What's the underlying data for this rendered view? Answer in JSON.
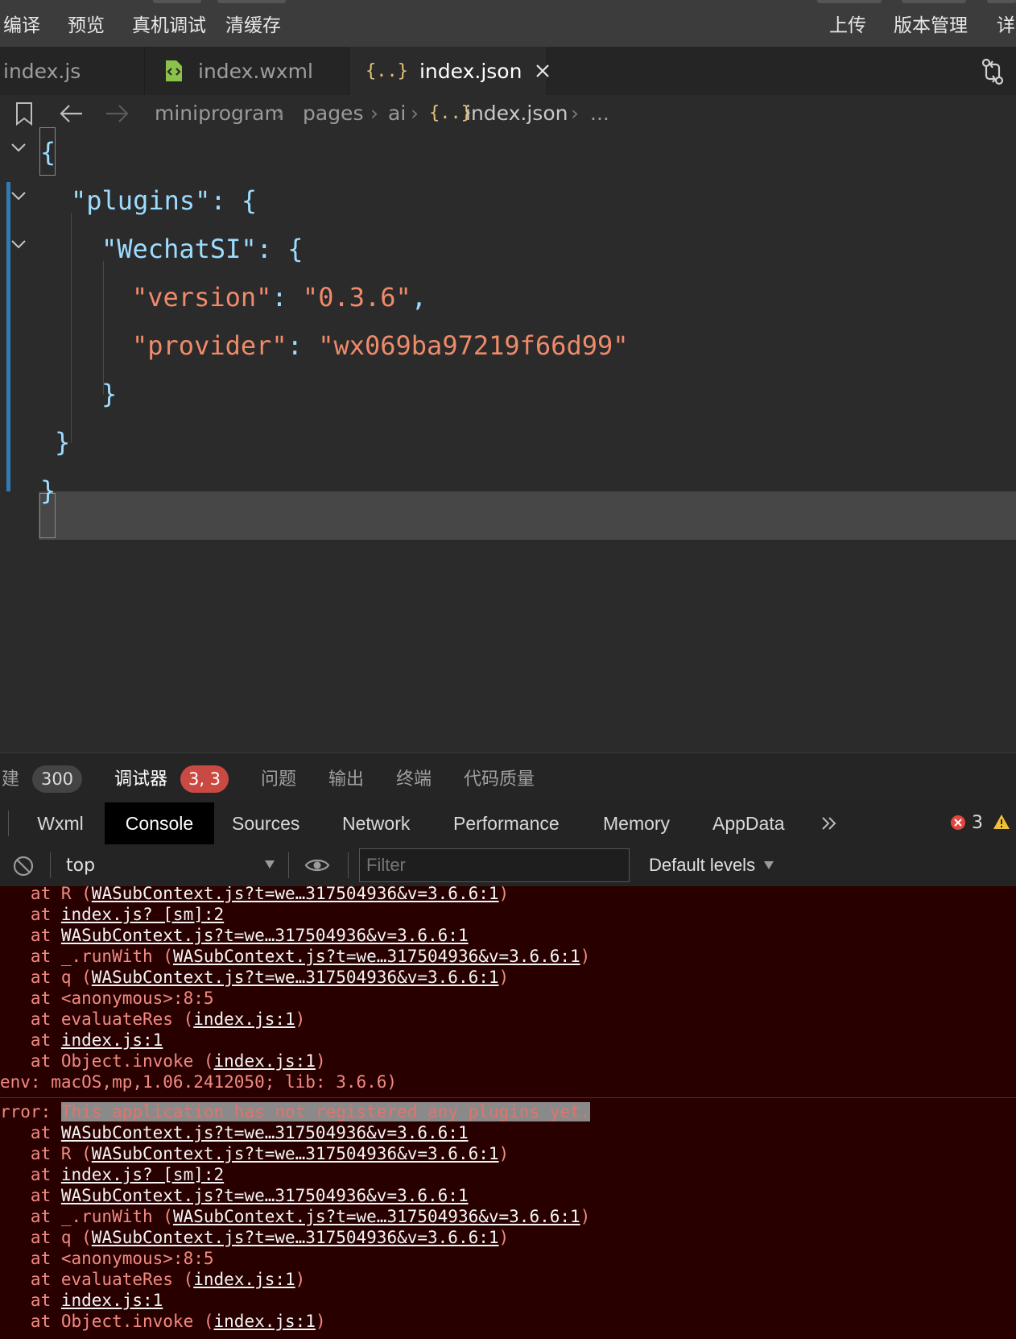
{
  "menu": {
    "left": [
      "编译",
      "预览",
      "真机调试",
      "清缓存"
    ],
    "right": [
      "上传",
      "版本管理",
      "详"
    ]
  },
  "tabs": [
    {
      "label": "index.js",
      "active": false
    },
    {
      "label": "index.wxml",
      "active": false
    },
    {
      "label": "index.json",
      "active": true
    }
  ],
  "breadcrumb": [
    "miniprogram",
    "pages",
    "ai",
    "index.json",
    "..."
  ],
  "editor": {
    "lines": [
      {
        "indent": 0,
        "key": "",
        "sep": "",
        "value": "",
        "text": "{"
      },
      {
        "indent": 1,
        "key": "\"plugins\"",
        "sep": ": ",
        "value": "{"
      },
      {
        "indent": 2,
        "key": "\"WechatSI\"",
        "sep": ": ",
        "value": "{"
      },
      {
        "indent": 3,
        "key": "\"version\"",
        "sep": ": ",
        "value": "\"0.3.6\"",
        "trail": ","
      },
      {
        "indent": 3,
        "key": "\"provider\"",
        "sep": ": ",
        "value": "\"wx069ba97219f66d99\""
      },
      {
        "indent": 2,
        "text": "}"
      },
      {
        "indent": 1,
        "text": "}"
      },
      {
        "indent": 0,
        "text": "}"
      }
    ]
  },
  "panel": {
    "build_label": "建",
    "build_count": "300",
    "debugger_label": "调试器",
    "debugger_count": "3, 3",
    "problems": "问题",
    "output": "输出",
    "terminal": "终端",
    "quality": "代码质量"
  },
  "devtools": {
    "tabs": [
      "Wxml",
      "Console",
      "Sources",
      "Network",
      "Performance",
      "Memory",
      "AppData"
    ],
    "active": "Console",
    "error_count": "3",
    "context": "top",
    "filter_placeholder": "Filter",
    "levels": "Default levels"
  },
  "console": {
    "lines": [
      {
        "pre": "   at R (",
        "link": "WASubContext.js?t=we…317504936&v=3.6.6:1",
        "post": ")"
      },
      {
        "pre": "   at ",
        "link": "index.js? [sm]:2",
        "post": ""
      },
      {
        "pre": "   at ",
        "link": "WASubContext.js?t=we…317504936&v=3.6.6:1",
        "post": ""
      },
      {
        "pre": "   at _.runWith (",
        "link": "WASubContext.js?t=we…317504936&v=3.6.6:1",
        "post": ")"
      },
      {
        "pre": "   at q (",
        "link": "WASubContext.js?t=we…317504936&v=3.6.6:1",
        "post": ")"
      },
      {
        "pre": "   at <anonymous>:8:5",
        "link": "",
        "post": ""
      },
      {
        "pre": "   at evaluateRes (",
        "link": "index.js:1",
        "post": ")"
      },
      {
        "pre": "   at ",
        "link": "index.js:1",
        "post": ""
      },
      {
        "pre": "   at Object.invoke (",
        "link": "index.js:1",
        "post": ")"
      },
      {
        "pre": "env: macOS,mp,1.06.2412050; lib: 3.6.6)",
        "link": "",
        "post": ""
      },
      {
        "pre": "rror: ",
        "highlight": "This application has not registered any plugins yet.",
        "link": "",
        "post": ""
      },
      {
        "pre": "   at ",
        "link": "WASubContext.js?t=we…317504936&v=3.6.6:1",
        "post": ""
      },
      {
        "pre": "   at R (",
        "link": "WASubContext.js?t=we…317504936&v=3.6.6:1",
        "post": ")"
      },
      {
        "pre": "   at ",
        "link": "index.js? [sm]:2",
        "post": ""
      },
      {
        "pre": "   at ",
        "link": "WASubContext.js?t=we…317504936&v=3.6.6:1",
        "post": ""
      },
      {
        "pre": "   at _.runWith (",
        "link": "WASubContext.js?t=we…317504936&v=3.6.6:1",
        "post": ")"
      },
      {
        "pre": "   at q (",
        "link": "WASubContext.js?t=we…317504936&v=3.6.6:1",
        "post": ")"
      },
      {
        "pre": "   at <anonymous>:8:5",
        "link": "",
        "post": ""
      },
      {
        "pre": "   at evaluateRes (",
        "link": "index.js:1",
        "post": ")"
      },
      {
        "pre": "   at ",
        "link": "index.js:1",
        "post": ""
      },
      {
        "pre": "   at Object.invoke (",
        "link": "index.js:1",
        "post": ")"
      }
    ]
  }
}
